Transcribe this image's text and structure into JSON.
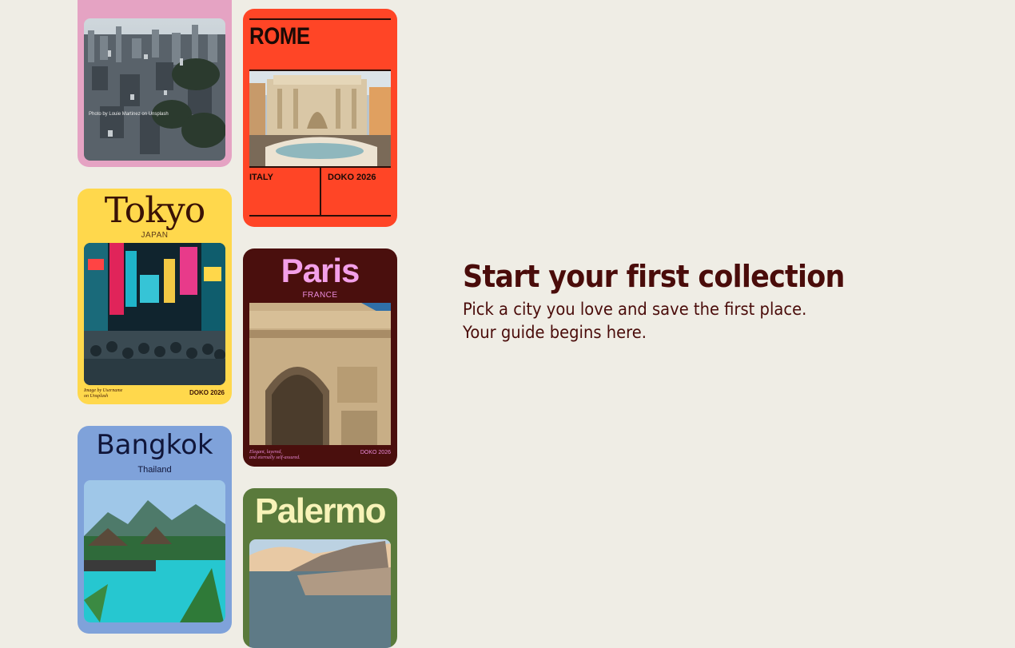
{
  "collections": {
    "top_card": {
      "credit": "Photo by Louie Martinez on Unsplash"
    },
    "rome": {
      "title": "ROME",
      "country": "ITALY",
      "brand": "DOKO 2026"
    },
    "tokyo": {
      "title": "Tokyo",
      "country": "JAPAN",
      "credit": "Image by Username\non Unsplash",
      "brand": "DOKO 2026"
    },
    "paris": {
      "title": "Paris",
      "country": "FRANCE",
      "tagline": "Elegant, layered,\nand eternally self-assured.",
      "brand": "DOKO 2026"
    },
    "bangkok": {
      "title": "Bangkok",
      "country": "Thailand"
    },
    "palermo": {
      "title": "Palermo"
    }
  },
  "empty_state": {
    "heading": "Start your first collection",
    "line1": "Pick a city you love and save the first place.",
    "line2": "Your guide begins here."
  },
  "colors": {
    "background": "#efede5",
    "pink": "#e5a3c3",
    "rome": "#ff4526",
    "tokyo": "#ffd84c",
    "paris": "#4a0f0d",
    "bangkok": "#7fa2da",
    "palermo": "#5a7a3c",
    "heading": "#4a0c0a"
  }
}
